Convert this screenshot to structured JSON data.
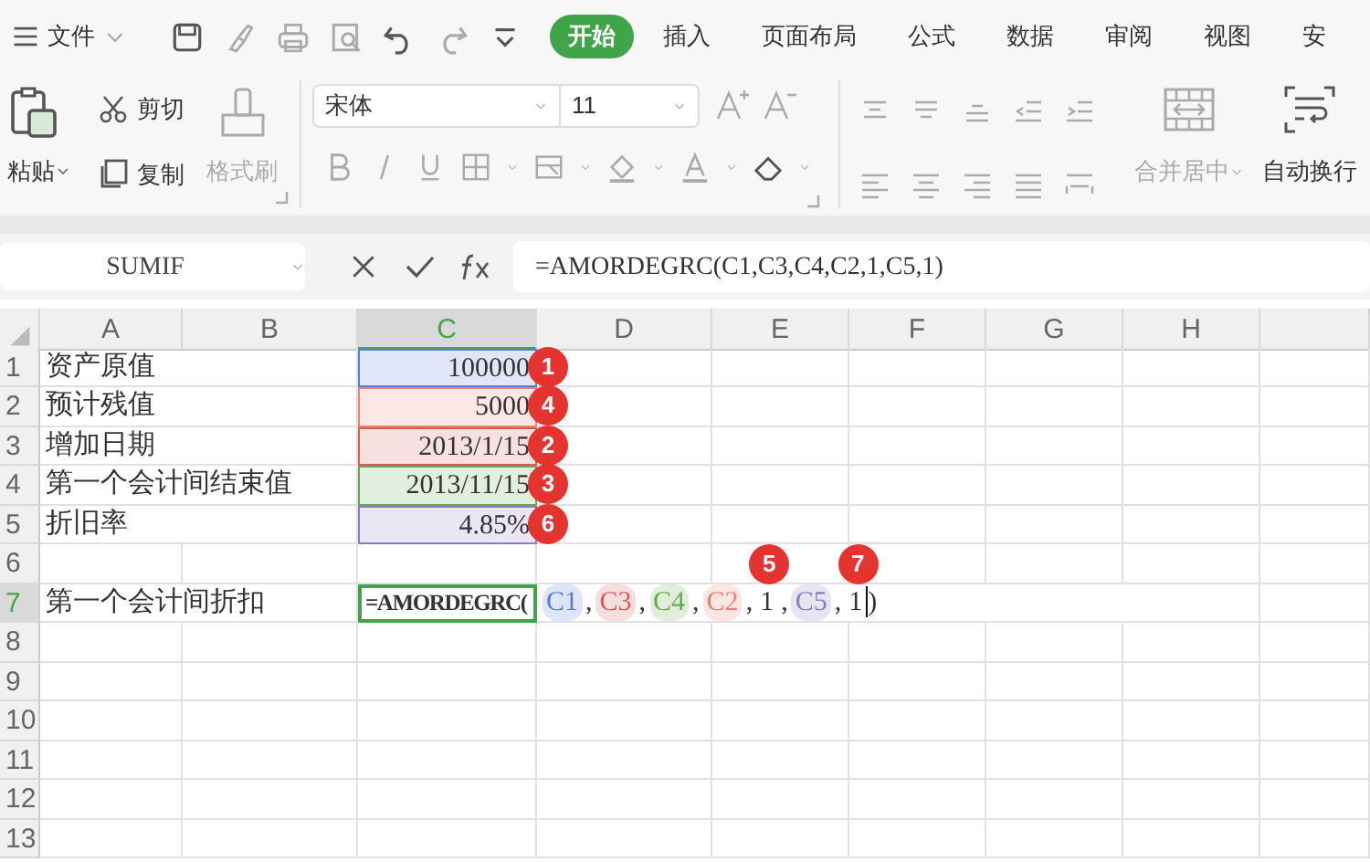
{
  "menu": {
    "label": "文件"
  },
  "tabs": [
    {
      "label": "开始",
      "selected": true
    },
    {
      "label": "插入",
      "selected": false
    },
    {
      "label": "页面布局",
      "selected": false
    },
    {
      "label": "公式",
      "selected": false
    },
    {
      "label": "数据",
      "selected": false
    },
    {
      "label": "审阅",
      "selected": false
    },
    {
      "label": "视图",
      "selected": false
    },
    {
      "label": "安",
      "selected": false
    }
  ],
  "clipboard": {
    "paste": {
      "label": "粘贴",
      "disabled": false
    },
    "cut": {
      "label": "剪切",
      "disabled": false
    },
    "copy": {
      "label": "复制",
      "disabled": false
    },
    "format_painter": {
      "label": "格式刷",
      "disabled": true
    }
  },
  "font": {
    "name": "宋体",
    "size": "11"
  },
  "alignment": {
    "merge": {
      "label": "合并居中",
      "disabled": true
    },
    "wrap": {
      "label": "自动换行",
      "disabled": false
    }
  },
  "formula_bar": {
    "name_box": "SUMIF",
    "formula": "=AMORDEGRC(C1,C3,C4,C2,1,C5,1)"
  },
  "columns": [
    {
      "label": "A",
      "selected": false
    },
    {
      "label": "B",
      "selected": false
    },
    {
      "label": "C",
      "selected": true
    },
    {
      "label": "D",
      "selected": false
    },
    {
      "label": "E",
      "selected": false
    },
    {
      "label": "F",
      "selected": false
    },
    {
      "label": "G",
      "selected": false
    },
    {
      "label": "H",
      "selected": false
    }
  ],
  "rows": [
    {
      "header": "1",
      "selected": false,
      "label": "资产原值",
      "value": "100000",
      "color": "#5b7bd5",
      "badge": "1"
    },
    {
      "header": "2",
      "selected": false,
      "label": "预计残值",
      "value": "5000",
      "color": "#e8836f",
      "badge": "4"
    },
    {
      "header": "3",
      "selected": false,
      "label": "增加日期",
      "value": "2013/1/15",
      "color": "#d65c5c",
      "badge": "2"
    },
    {
      "header": "4",
      "selected": false,
      "label": "第一个会计间结束值",
      "value": "2013/11/15",
      "color": "#6aa84f",
      "badge": "3"
    },
    {
      "header": "5",
      "selected": false,
      "label": "折旧率",
      "value": "4.85%",
      "color": "#8e7cc3",
      "badge": "6"
    },
    {
      "header": "6",
      "selected": false
    },
    {
      "header": "7",
      "selected": true,
      "label": "第一个会计间折扣",
      "formula": [
        {
          "kind": "text",
          "text": "=AMORDEGRC("
        },
        {
          "kind": "ref",
          "text": "C1",
          "color": "#5b7bd5"
        },
        {
          "kind": "text",
          "text": ","
        },
        {
          "kind": "ref",
          "text": "C3",
          "color": "#d65c5c"
        },
        {
          "kind": "text",
          "text": ","
        },
        {
          "kind": "ref",
          "text": "C4",
          "color": "#6aa84f"
        },
        {
          "kind": "text",
          "text": ","
        },
        {
          "kind": "ref",
          "text": "C2",
          "color": "#e8836f"
        },
        {
          "kind": "text",
          "text": ","
        },
        {
          "kind": "text",
          "text": "1",
          "badge": "5"
        },
        {
          "kind": "text",
          "text": ","
        },
        {
          "kind": "ref",
          "text": "C5",
          "color": "#8e7cc3"
        },
        {
          "kind": "text",
          "text": ","
        },
        {
          "kind": "text",
          "text": "1",
          "badge": "7"
        },
        {
          "kind": "cursor"
        },
        {
          "kind": "text",
          "text": ")"
        }
      ]
    },
    {
      "header": "8",
      "selected": false
    },
    {
      "header": "9",
      "selected": false
    },
    {
      "header": "10",
      "selected": false
    },
    {
      "header": "11",
      "selected": false
    },
    {
      "header": "12",
      "selected": false
    },
    {
      "header": "13",
      "selected": false
    }
  ]
}
